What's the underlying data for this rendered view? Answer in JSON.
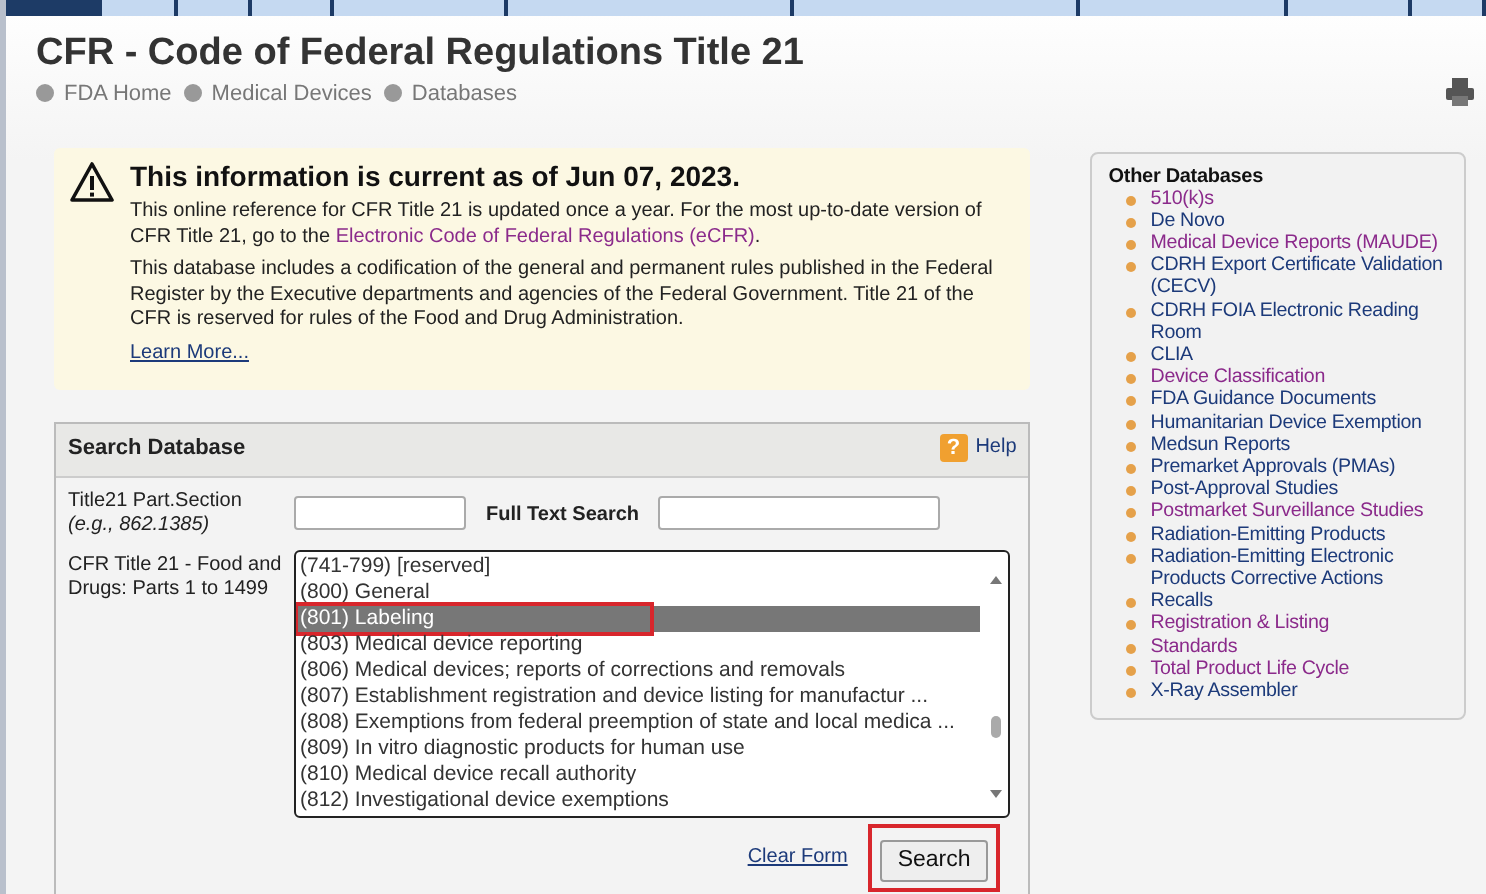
{
  "header": {
    "title": "CFR - Code of Federal Regulations Title 21",
    "breadcrumbs": [
      "FDA Home",
      "Medical Devices",
      "Databases"
    ]
  },
  "notice": {
    "heading": "This information is current as of Jun 07, 2023.",
    "paragraph_1": "This online reference for CFR Title 21 is updated once a year. For the most up-to-date version of CFR Title 21, go to the ",
    "paragraph_1_link": "Electronic Code of Federal Regulations (eCFR)",
    "paragraph_1_end": ".",
    "paragraph_2": "This database includes a codification of the general and permanent rules published in the Federal Register by the Executive departments and agencies of the Federal Government. Title 21 of the CFR is reserved for rules of the Food and Drug Administration.",
    "learn_more": "Learn More..."
  },
  "search": {
    "title": "Search Database",
    "help_icon": "?",
    "help": "Help",
    "part_label": "Title21 Part.Section",
    "part_hint": "(e.g., 862.1385)",
    "full_text_label": "Full Text Search",
    "list_label": "CFR Title 21 - Food and Drugs: Parts 1 to 1499",
    "options": [
      {
        "label": "(741-799) [reserved]",
        "selected": false,
        "highlighted": false
      },
      {
        "label": "(800) General",
        "selected": false,
        "highlighted": false
      },
      {
        "label": "(801) Labeling",
        "selected": true,
        "highlighted": true
      },
      {
        "label": "(803) Medical device reporting",
        "selected": false,
        "highlighted": false
      },
      {
        "label": "(806) Medical devices; reports of corrections and removals",
        "selected": false,
        "highlighted": false
      },
      {
        "label": "(807) Establishment registration and device listing for manufactur ...",
        "selected": false,
        "highlighted": false
      },
      {
        "label": "(808) Exemptions from federal preemption of state and local medica ...",
        "selected": false,
        "highlighted": false
      },
      {
        "label": "(809) In vitro diagnostic products for human use",
        "selected": false,
        "highlighted": false
      },
      {
        "label": "(810) Medical device recall authority",
        "selected": false,
        "highlighted": false
      },
      {
        "label": "(812) Investigational device exemptions",
        "selected": false,
        "highlighted": false
      }
    ],
    "clear_form": "Clear Form",
    "search_button": {
      "label": "Search",
      "highlighted": true
    }
  },
  "other_databases": {
    "title": "Other Databases",
    "items": [
      {
        "label": "510(k)s",
        "visited": true
      },
      {
        "label": "De Novo",
        "visited": false
      },
      {
        "label": "Medical Device Reports (MAUDE)",
        "visited": true
      },
      {
        "label": "CDRH Export Certificate Validation (CECV)",
        "visited": false
      },
      {
        "label": "CDRH FOIA Electronic Reading Room",
        "visited": false
      },
      {
        "label": "CLIA",
        "visited": false
      },
      {
        "label": "Device Classification",
        "visited": true
      },
      {
        "label": "FDA Guidance Documents",
        "visited": false
      },
      {
        "label": "Humanitarian Device Exemption",
        "visited": false
      },
      {
        "label": "Medsun Reports",
        "visited": false
      },
      {
        "label": "Premarket Approvals (PMAs)",
        "visited": false
      },
      {
        "label": "Post-Approval Studies",
        "visited": false
      },
      {
        "label": "Postmarket Surveillance Studies",
        "visited": true
      },
      {
        "label": "Radiation-Emitting Products",
        "visited": false
      },
      {
        "label": "Radiation-Emitting Electronic Products Corrective Actions",
        "visited": false
      },
      {
        "label": "Recalls",
        "visited": false
      },
      {
        "label": "Registration & Listing",
        "visited": true
      },
      {
        "label": "Standards",
        "visited": true
      },
      {
        "label": "Total Product Life Cycle",
        "visited": true
      },
      {
        "label": "X-Ray Assembler",
        "visited": false
      }
    ]
  }
}
